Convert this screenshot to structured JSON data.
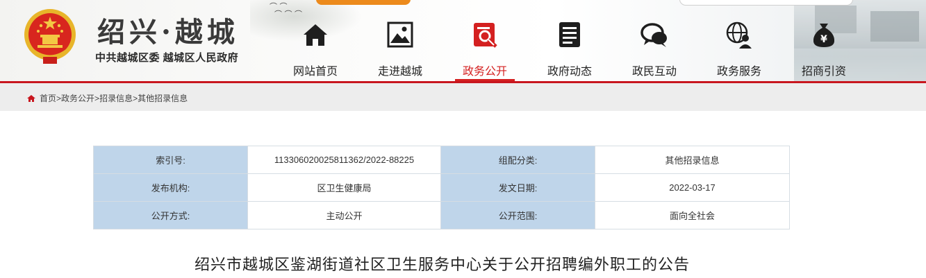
{
  "site": {
    "title": "绍兴·越城",
    "subtitle": "中共越城区委  越城区人民政府"
  },
  "nav": [
    {
      "label": "网站首页",
      "icon": "home-icon",
      "active": false
    },
    {
      "label": "走进越城",
      "icon": "picture-icon",
      "active": false
    },
    {
      "label": "政务公开",
      "icon": "document-search-icon",
      "active": true
    },
    {
      "label": "政府动态",
      "icon": "news-list-icon",
      "active": false
    },
    {
      "label": "政民互动",
      "icon": "chat-bubble-icon",
      "active": false
    },
    {
      "label": "政务服务",
      "icon": "globe-user-icon",
      "active": false
    },
    {
      "label": "招商引资",
      "icon": "money-bag-icon",
      "active": false
    }
  ],
  "breadcrumb": {
    "items": [
      "首页",
      "政务公开",
      "招录信息",
      "其他招录信息"
    ],
    "separator": ">"
  },
  "meta_table": {
    "rows": [
      {
        "k1": "索引号:",
        "v1": "113306020025811362/2022-88225",
        "k2": "组配分类:",
        "v2": "其他招录信息"
      },
      {
        "k1": "发布机构:",
        "v1": "区卫生健康局",
        "k2": "发文日期:",
        "v2": "2022-03-17"
      },
      {
        "k1": "公开方式:",
        "v1": "主动公开",
        "k2": "公开范围:",
        "v2": "面向全社会"
      }
    ]
  },
  "document": {
    "title": "绍兴市越城区鉴湖街道社区卫生服务中心关于公开招聘编外职工的公告"
  },
  "colors": {
    "accent_red": "#d42020",
    "header_rule": "#c8161e",
    "table_key_bg": "#bfd5ea",
    "top_tab": "#ec8a1c"
  }
}
